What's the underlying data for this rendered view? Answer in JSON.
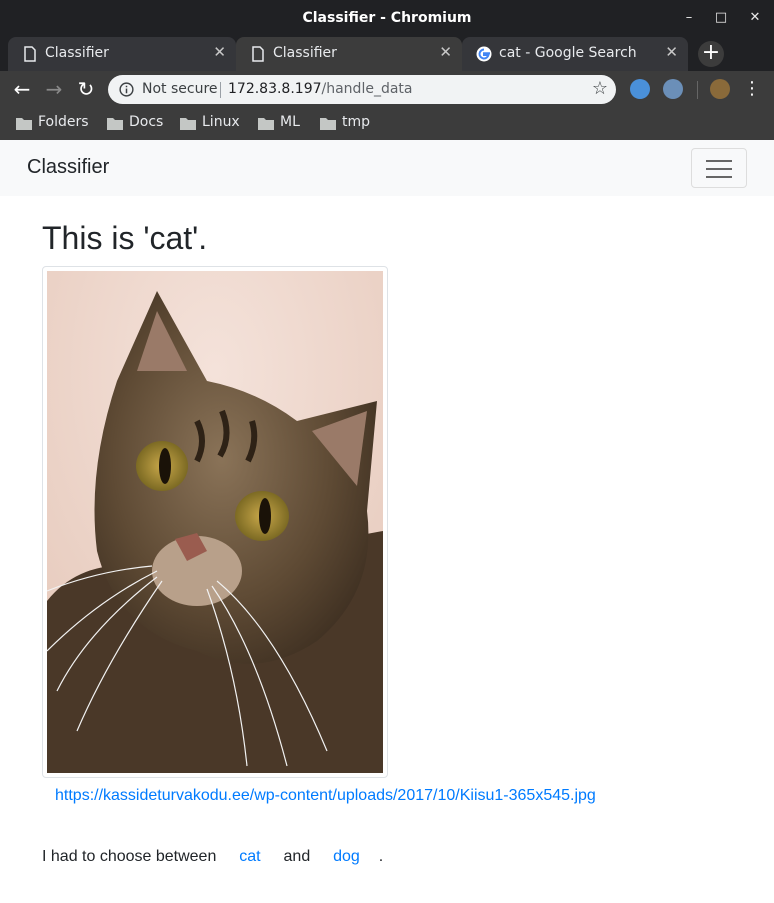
{
  "window": {
    "title": "Classifier - Chromium"
  },
  "tabs": [
    {
      "label": "Classifier"
    },
    {
      "label": "Classifier"
    },
    {
      "label": "cat - Google Search"
    }
  ],
  "address_bar": {
    "security_label": "Not secure",
    "host": "172.83.8.197",
    "path": "/handle_data"
  },
  "bookmarks": [
    {
      "label": "Folders"
    },
    {
      "label": "Docs"
    },
    {
      "label": "Linux"
    },
    {
      "label": "ML"
    },
    {
      "label": "tmp"
    }
  ],
  "page": {
    "brand": "Classifier",
    "heading": "This is 'cat'.",
    "image_url": "https://kassideturvakodu.ee/wp-content/uploads/2017/10/Kiisu1-365x545.jpg",
    "choose_prefix": "I had to choose between",
    "option_1": "cat",
    "conjunction": "and",
    "option_2": "dog",
    "suffix": "."
  },
  "colors": {
    "accent": "#007bff",
    "navbar_bg": "#f8f9fa",
    "browser_chrome": "#202124"
  }
}
